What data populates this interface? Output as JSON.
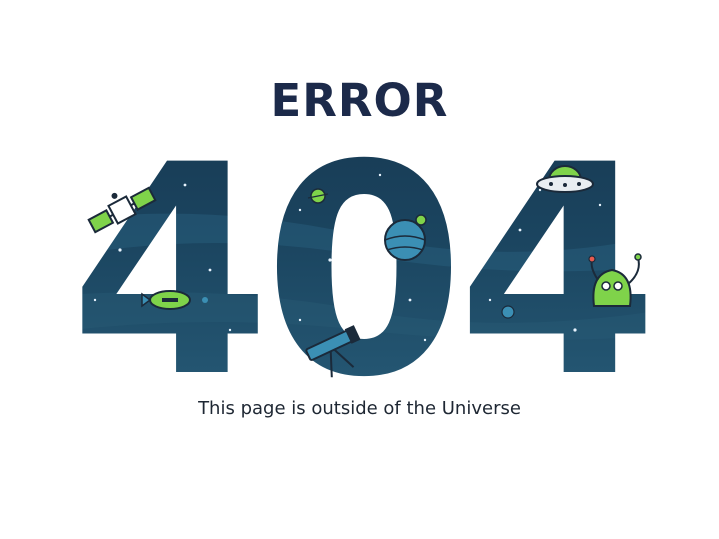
{
  "page": {
    "title": "ERROR",
    "code": "404",
    "message": "This page is outside of the Universe"
  },
  "colors": {
    "title": "#1c2a4a",
    "space_dark": "#143048",
    "space_mid": "#1e4a63",
    "space_light": "#2b5e78",
    "planet_blue": "#3b8fb4",
    "alien_green": "#7fd34a",
    "outline": "#1b2a3a",
    "star": "#e8f4ff",
    "text": "#1e2733"
  },
  "icons": [
    "satellite-icon",
    "rocket-icon",
    "telescope-icon",
    "planet-icon",
    "ufo-icon",
    "alien-icon"
  ]
}
